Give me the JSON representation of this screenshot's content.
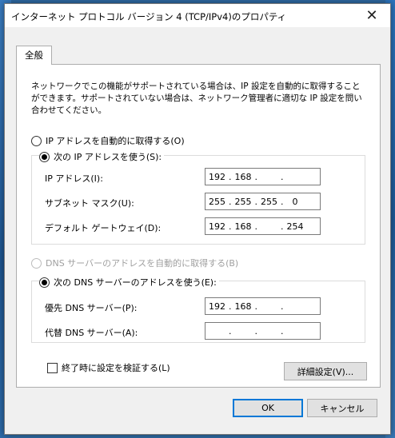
{
  "window": {
    "title": "インターネット プロトコル バージョン 4 (TCP/IPv4)のプロパティ",
    "close_glyph": "✕"
  },
  "tabs": [
    {
      "label": "全般"
    }
  ],
  "description": "ネットワークでこの機能がサポートされている場合は、IP 設定を自動的に取得することができます。サポートされていない場合は、ネットワーク管理者に適切な IP 設定を問い合わせてください。",
  "ip_section": {
    "auto_label": "IP アドレスを自動的に取得する(O)",
    "manual_label": "次の IP アドレスを使う(S):",
    "selected": "manual",
    "fields": [
      {
        "label": "IP アドレス(I):",
        "octets": [
          "192",
          "168",
          "",
          ""
        ]
      },
      {
        "label": "サブネット マスク(U):",
        "octets": [
          "255",
          "255",
          "255",
          "0"
        ]
      },
      {
        "label": "デフォルト ゲートウェイ(D):",
        "octets": [
          "192",
          "168",
          "",
          "254"
        ]
      }
    ]
  },
  "dns_section": {
    "auto_label": "DNS サーバーのアドレスを自動的に取得する(B)",
    "auto_disabled": true,
    "manual_label": "次の DNS サーバーのアドレスを使う(E):",
    "selected": "manual",
    "fields": [
      {
        "label": "優先 DNS サーバー(P):",
        "octets": [
          "192",
          "168",
          "",
          ""
        ]
      },
      {
        "label": "代替 DNS サーバー(A):",
        "octets": [
          "",
          "",
          "",
          ""
        ]
      }
    ]
  },
  "validate_on_exit": {
    "label": "終了時に設定を検証する(L)",
    "checked": false
  },
  "buttons": {
    "advanced": "詳細設定(V)...",
    "ok": "OK",
    "cancel": "キャンセル"
  },
  "colors": {
    "accent": "#0078d7",
    "desktop": "#2f6aa3"
  }
}
